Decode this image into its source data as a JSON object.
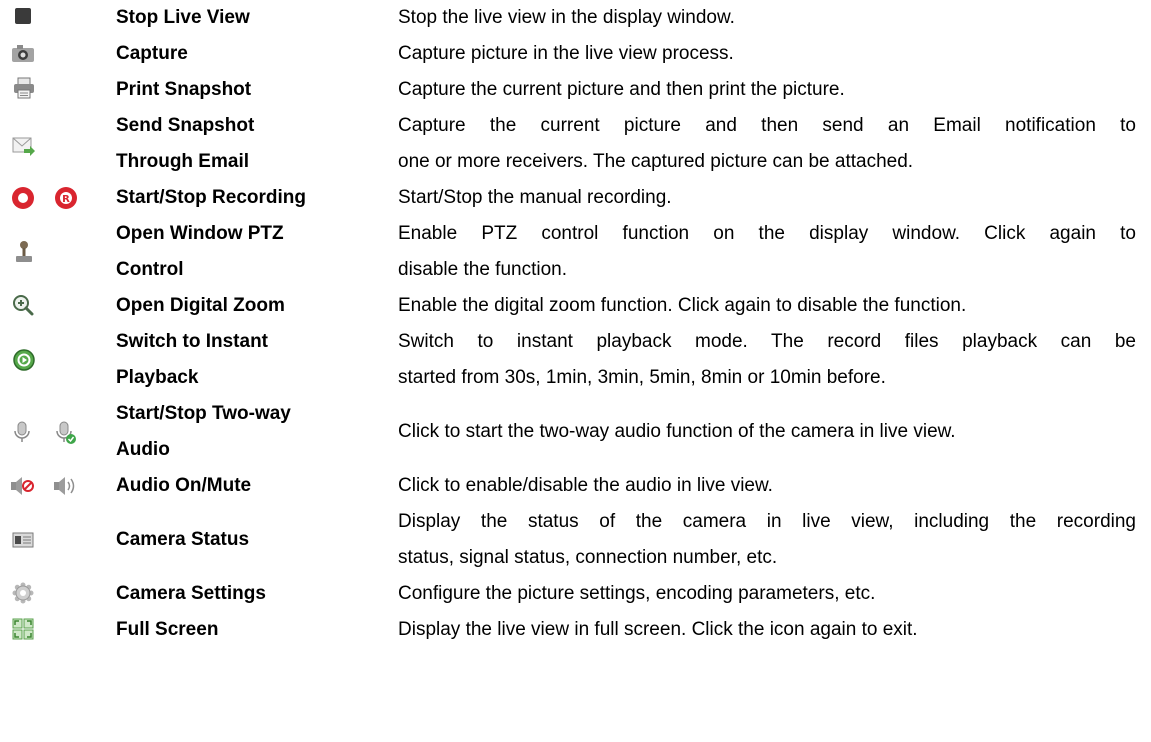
{
  "rows": [
    {
      "name": "Stop Live View",
      "desc": "Stop the live view in the display window.",
      "icons": [
        "stop-icon"
      ]
    },
    {
      "name": "Capture",
      "desc": "Capture picture in the live view process.",
      "icons": [
        "camera-icon"
      ]
    },
    {
      "name": "Print Snapshot",
      "desc": "Capture the current picture and then print the picture.",
      "icons": [
        "printer-icon"
      ]
    },
    {
      "name_lines": [
        "Send Snapshot",
        "Through Email"
      ],
      "desc_lines": [
        "Capture the current picture and then send an Email notification to",
        "one or more receivers. The captured picture can be attached."
      ],
      "icons": [
        "email-send-icon"
      ]
    },
    {
      "name": "Start/Stop Recording",
      "desc": "Start/Stop the manual recording.",
      "icons": [
        "record-start-icon",
        "record-stop-icon"
      ]
    },
    {
      "name_lines": [
        "Open Window PTZ",
        "Control"
      ],
      "desc_lines": [
        "Enable PTZ control function on the display window. Click again to",
        "disable the function."
      ],
      "icons": [
        "ptz-joystick-icon"
      ]
    },
    {
      "name": "Open Digital Zoom",
      "desc": "Enable the digital zoom function. Click again to disable the function.",
      "icons": [
        "zoom-in-icon"
      ]
    },
    {
      "name_lines": [
        "Switch to Instant",
        "Playback"
      ],
      "desc_lines": [
        "Switch to instant playback mode. The record files playback can be",
        "started from 30s, 1min, 3min, 5min, 8min or 10min before."
      ],
      "icons": [
        "instant-playback-icon"
      ]
    },
    {
      "name_lines": [
        "Start/Stop Two-way",
        "Audio"
      ],
      "desc": "Click to start the two-way audio function of the camera in live view.",
      "icons": [
        "microphone-icon",
        "microphone-active-icon"
      ]
    },
    {
      "name": "Audio On/Mute",
      "desc": "Click to enable/disable the audio in live view.",
      "icons": [
        "speaker-muted-icon",
        "speaker-on-icon"
      ]
    },
    {
      "name": "Camera Status",
      "desc_lines": [
        "Display the status of the camera in live view, including the recording",
        "status, signal status, connection number, etc."
      ],
      "icons": [
        "camera-status-icon"
      ]
    },
    {
      "name": "Camera Settings",
      "desc": "Configure the picture settings, encoding parameters, etc.",
      "icons": [
        "settings-gear-icon"
      ]
    },
    {
      "name": "Full Screen",
      "desc": "Display the live view in full screen. Click the icon again to exit.",
      "icons": [
        "full-screen-icon"
      ]
    }
  ]
}
